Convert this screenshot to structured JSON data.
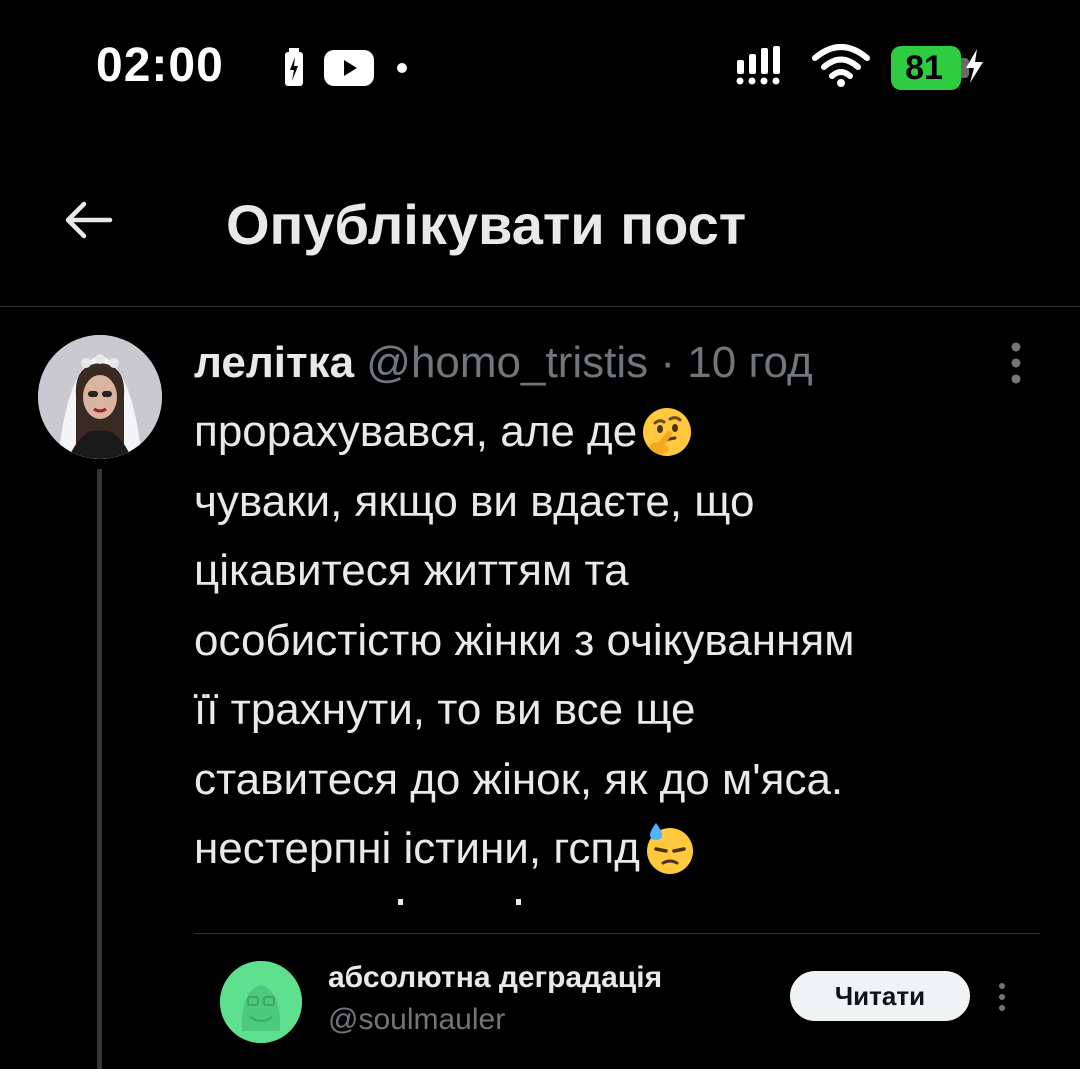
{
  "status_bar": {
    "time": "02:00",
    "battery_level": "81",
    "icons": [
      "battery-saver-icon",
      "youtube-icon",
      "notification-dot-icon",
      "signal-icon",
      "wifi-icon",
      "battery-icon",
      "charging-bolt-icon"
    ]
  },
  "header": {
    "back_icon": "arrow-left-icon",
    "title": "Опублікувати пост"
  },
  "post": {
    "author_name": "лелітка",
    "author_handle": "@homo_tristis",
    "separator": "·",
    "time": "10 год",
    "more_icon": "more-vertical-icon",
    "lines": [
      "прорахувався, але де",
      "чуваки, якщо ви вдаєте, що",
      "цікавитеся життям та",
      "особистістю жінки з очікуванням",
      "її трахнути, то ви все ще",
      "ставитеся до жінок, як до м'яса.",
      "нестерпні істини, гспд"
    ],
    "emojis": [
      "thinking-face-emoji",
      "downcast-face-with-sweat-emoji"
    ]
  },
  "suggestion": {
    "name": "абсолютна деградація",
    "handle": "@soulmauler",
    "button_label": "Читати",
    "more_icon": "more-vertical-icon"
  },
  "colors": {
    "background": "#000000",
    "text_primary": "#e7e9ea",
    "text_secondary": "#71767b",
    "battery": "#2ecc40",
    "divider": "#2f3336",
    "suggest_avatar": "#5fe08e"
  }
}
